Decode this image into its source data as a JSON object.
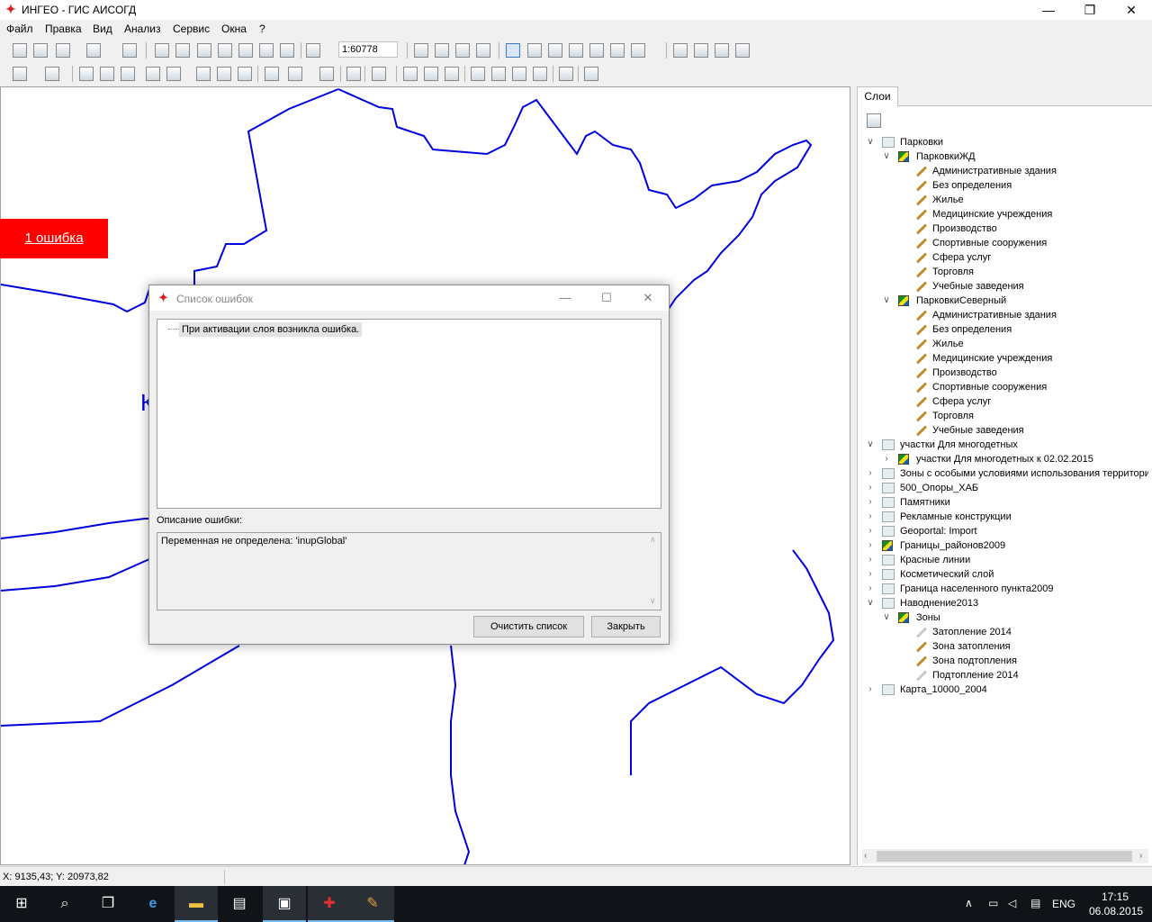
{
  "window": {
    "title": "ИНГЕО - ГИС АИСОГД",
    "minimize": "—",
    "restore": "❐",
    "close": "✕"
  },
  "menu": [
    "Файл",
    "Правка",
    "Вид",
    "Анализ",
    "Сервис",
    "Окна",
    "?"
  ],
  "toolbar": {
    "scale_value": "1:60778"
  },
  "map": {
    "error_badge": "1 ошибка",
    "partial_label": "К"
  },
  "layers_panel": {
    "tab_label": "Слои",
    "tree": [
      {
        "level": 0,
        "expand": "open",
        "icon": "folder",
        "label": "Парковки"
      },
      {
        "level": 1,
        "expand": "open",
        "icon": "layer",
        "label": "ПарковкиЖД"
      },
      {
        "level": 2,
        "icon": "pencil",
        "label": "Административные здания"
      },
      {
        "level": 2,
        "icon": "pencil",
        "label": "Без определения"
      },
      {
        "level": 2,
        "icon": "pencil",
        "label": "Жилье"
      },
      {
        "level": 2,
        "icon": "pencil",
        "label": "Медицинские учреждения"
      },
      {
        "level": 2,
        "icon": "pencil",
        "label": "Производство"
      },
      {
        "level": 2,
        "icon": "pencil",
        "label": "Спортивные сооружения"
      },
      {
        "level": 2,
        "icon": "pencil",
        "label": "Сфера услуг"
      },
      {
        "level": 2,
        "icon": "pencil",
        "label": "Торговля"
      },
      {
        "level": 2,
        "icon": "pencil",
        "label": "Учебные заведения"
      },
      {
        "level": 1,
        "expand": "open",
        "icon": "layer",
        "label": "ПарковкиСеверный"
      },
      {
        "level": 2,
        "icon": "pencil",
        "label": "Административные здания"
      },
      {
        "level": 2,
        "icon": "pencil",
        "label": "Без определения"
      },
      {
        "level": 2,
        "icon": "pencil",
        "label": "Жилье"
      },
      {
        "level": 2,
        "icon": "pencil",
        "label": "Медицинские учреждения"
      },
      {
        "level": 2,
        "icon": "pencil",
        "label": "Производство"
      },
      {
        "level": 2,
        "icon": "pencil",
        "label": "Спортивные сооружения"
      },
      {
        "level": 2,
        "icon": "pencil",
        "label": "Сфера услуг"
      },
      {
        "level": 2,
        "icon": "pencil",
        "label": "Торговля"
      },
      {
        "level": 2,
        "icon": "pencil",
        "label": "Учебные заведения"
      },
      {
        "level": 0,
        "expand": "open",
        "icon": "folder",
        "label": "участки Для многодетных"
      },
      {
        "level": 1,
        "expand": "closed",
        "icon": "layer",
        "label": "участки Для многодетных к 02.02.2015"
      },
      {
        "level": 0,
        "expand": "closed",
        "icon": "folder",
        "label": "Зоны с особыми условиями использования территории"
      },
      {
        "level": 0,
        "expand": "closed",
        "icon": "folder",
        "label": "500_Опоры_ХАБ"
      },
      {
        "level": 0,
        "expand": "closed",
        "icon": "folder",
        "label": "Памятники"
      },
      {
        "level": 0,
        "expand": "closed",
        "icon": "folder",
        "label": "Рекламные конструкции"
      },
      {
        "level": 0,
        "expand": "closed",
        "icon": "folder",
        "label": "Geoportal: Import"
      },
      {
        "level": 0,
        "expand": "closed",
        "icon": "layer",
        "label": "Границы_районов2009"
      },
      {
        "level": 0,
        "expand": "closed",
        "icon": "folder",
        "label": "Красные линии"
      },
      {
        "level": 0,
        "expand": "closed",
        "icon": "folder",
        "label": "Косметический слой"
      },
      {
        "level": 0,
        "expand": "closed",
        "icon": "folder",
        "label": "Граница населенного пункта2009"
      },
      {
        "level": 0,
        "expand": "open",
        "icon": "folder",
        "label": "Наводнение2013"
      },
      {
        "level": 1,
        "expand": "open",
        "icon": "layer",
        "label": "Зоны"
      },
      {
        "level": 2,
        "icon": "pencil-gray",
        "label": "Затопление 2014"
      },
      {
        "level": 2,
        "icon": "pencil",
        "label": "Зона затопления"
      },
      {
        "level": 2,
        "icon": "pencil",
        "label": "Зона подтопления"
      },
      {
        "level": 2,
        "icon": "pencil-gray",
        "label": "Подтопление 2014"
      },
      {
        "level": 0,
        "expand": "closed",
        "icon": "folder",
        "label": "Карта_10000_2004"
      }
    ]
  },
  "status": {
    "coords": "X: 9135,43; Y: 20973,82"
  },
  "taskbar": {
    "language": "ENG",
    "time": "17:15",
    "date": "06.08.2015"
  },
  "dialog": {
    "title": "Список ошибок",
    "error_item": "При активации слоя возникла ошибка.",
    "description_label": "Описание ошибки:",
    "description_text": "Переменная не определена: 'inupGlobal'",
    "clear_button": "Очистить список",
    "close_button": "Закрыть"
  },
  "colors": {
    "map_line": "#0000dd",
    "error_badge_bg": "#ff0000",
    "taskbar_bg": "#101418"
  }
}
